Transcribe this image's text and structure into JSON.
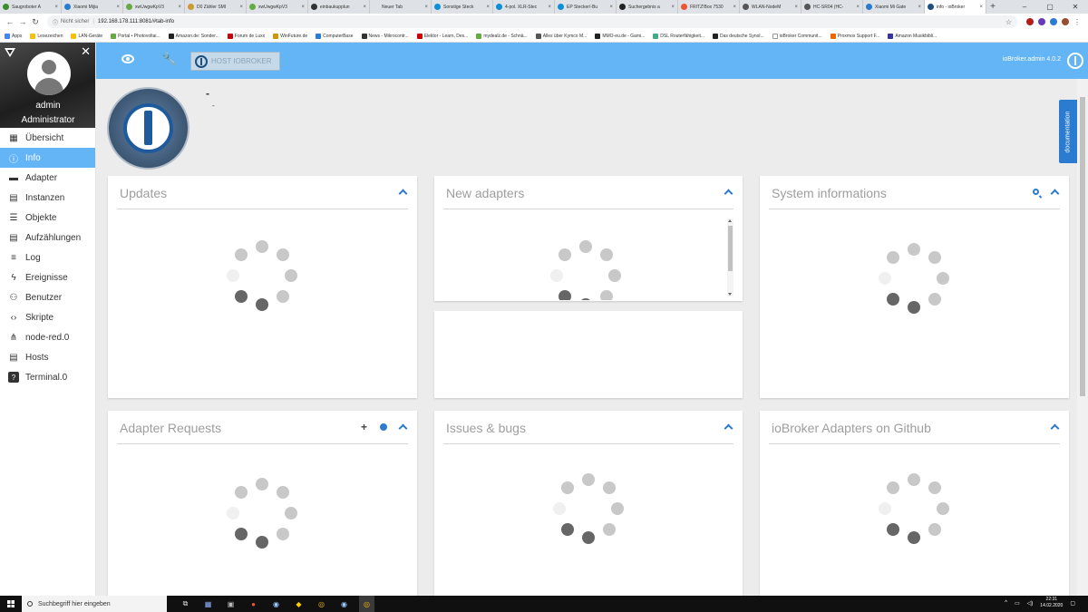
{
  "browser": {
    "tabs": [
      {
        "label": "Saugroboter A",
        "icon": "#3c8d2f"
      },
      {
        "label": "Xiaomi Mijia",
        "icon": "#2b7bd0"
      },
      {
        "label": "xwUwgwKpV3",
        "icon": "#6a4"
      },
      {
        "label": "D0 Zähler SMI",
        "icon": "#c93"
      },
      {
        "label": "xwUwgwKpV3",
        "icon": "#6a4"
      },
      {
        "label": "einbaukupplun",
        "icon": "#333"
      },
      {
        "label": "Neuer Tab",
        "icon": ""
      },
      {
        "label": "Sonstige Steck",
        "icon": "#0a8fd8"
      },
      {
        "label": "4-pol. XLR-Stec",
        "icon": "#0a8fd8"
      },
      {
        "label": "EP Stecker/-Bu",
        "icon": "#0a8fd8"
      },
      {
        "label": "Suchergebnis a",
        "icon": "#222"
      },
      {
        "label": "FRITZ!Box 7530",
        "icon": "#e53"
      },
      {
        "label": "WLAN-NodeM",
        "icon": "#555"
      },
      {
        "label": "HC-SR04 (HC-",
        "icon": "#555"
      },
      {
        "label": "Xiaomi Mi Gate",
        "icon": "#2b7bd0"
      },
      {
        "label": "info - ioBroker",
        "icon": "#1e4f80",
        "active": true
      }
    ],
    "address_security": "Nicht sicher",
    "address_url": "192.168.178.111:8081/#tab-info",
    "bookmarks": [
      {
        "label": "Apps",
        "color": "#4285f4"
      },
      {
        "label": "Lesezeichen",
        "color": "#f4c20d"
      },
      {
        "label": "LAN-Geräte",
        "color": "#f4c20d"
      },
      {
        "label": "Portal • Photovoltai...",
        "color": "#6a4"
      },
      {
        "label": "Amazon.de: Sonder...",
        "color": "#222"
      },
      {
        "label": "Forum de Luxx",
        "color": "#c00"
      },
      {
        "label": "WinFuture.de",
        "color": "#c90"
      },
      {
        "label": "ComputerBase",
        "color": "#2b7bd0"
      },
      {
        "label": "News - Mikrocontr...",
        "color": "#333"
      },
      {
        "label": "Elektor - Learn, Des...",
        "color": "#c00"
      },
      {
        "label": "mydealz.de - Schnä...",
        "color": "#6a4"
      },
      {
        "label": "Alles über Kymco M...",
        "color": "#555"
      },
      {
        "label": "MMO-eu.de - Gami...",
        "color": "#222"
      },
      {
        "label": "DSL Routerfähigkeit...",
        "color": "#4a8"
      },
      {
        "label": "Das deutsche Synol...",
        "color": "#222"
      },
      {
        "label": "ioBroker Communit...",
        "color": "#fff"
      },
      {
        "label": "Proxmox Support F...",
        "color": "#e60"
      },
      {
        "label": "Amazon Musikbibli...",
        "color": "#33a"
      }
    ]
  },
  "sidebar": {
    "user_name": "admin",
    "user_role": "Administrator",
    "items": [
      {
        "label": "Übersicht",
        "icon": "grid-icon"
      },
      {
        "label": "Info",
        "icon": "info-icon",
        "active": true
      },
      {
        "label": "Adapter",
        "icon": "store-icon"
      },
      {
        "label": "Instanzen",
        "icon": "instances-icon"
      },
      {
        "label": "Objekte",
        "icon": "list-icon"
      },
      {
        "label": "Aufzählungen",
        "icon": "enum-icon"
      },
      {
        "label": "Log",
        "icon": "log-icon"
      },
      {
        "label": "Ereignisse",
        "icon": "flash-icon"
      },
      {
        "label": "Benutzer",
        "icon": "user-icon"
      },
      {
        "label": "Skripte",
        "icon": "code-icon"
      },
      {
        "label": "node-red.0",
        "icon": "nodered-icon"
      },
      {
        "label": "Hosts",
        "icon": "hosts-icon"
      },
      {
        "label": "Terminal.0",
        "icon": "help-box-icon"
      }
    ]
  },
  "header": {
    "host_label": "HOST IOBROKER",
    "version": "ioBroker.admin 4.0.2"
  },
  "info": {
    "line1": "-",
    "line2": "-",
    "documentation_label": "documentation"
  },
  "cards": {
    "updates": "Updates",
    "new_adapters": "New adapters",
    "system_info": "System informations",
    "adapter_requests": "Adapter Requests",
    "issues": "Issues & bugs",
    "github": "ioBroker Adapters on Github"
  },
  "taskbar": {
    "search_placeholder": "Suchbegriff hier eingeben",
    "time": "22:31",
    "date": "14.02.2020"
  },
  "colors": {
    "accent": "#64b5f6",
    "link": "#2b7bd0"
  }
}
